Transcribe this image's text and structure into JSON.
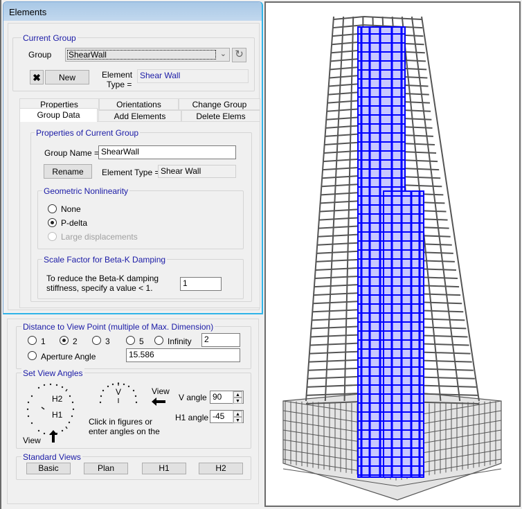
{
  "window": {
    "title": "Elements"
  },
  "current_group": {
    "legend": "Current Group",
    "group_label": "Group",
    "group_value": "ShearWall",
    "new_label": "New",
    "element_type_label_1": "Element",
    "element_type_label_2": "Type =",
    "element_type_value": "Shear Wall"
  },
  "tabs": {
    "row1": [
      "Properties",
      "Orientations",
      "Change Group"
    ],
    "row2": [
      "Group Data",
      "Add Elements",
      "Delete Elems"
    ],
    "active": "Group Data"
  },
  "group_data": {
    "legend": "Properties of Current Group",
    "group_name_label": "Group Name =",
    "group_name_value": "ShearWall",
    "rename_label": "Rename",
    "element_type_label": "Element Type =",
    "element_type_value": "Shear Wall",
    "nonlinearity": {
      "legend": "Geometric Nonlinearity",
      "options": [
        "None",
        "P-delta",
        "Large displacements"
      ],
      "selected": "P-delta",
      "disabled": [
        "Large displacements"
      ]
    },
    "damping": {
      "legend": "Scale Factor for Beta-K Damping",
      "text_1": "To reduce the Beta-K damping",
      "text_2": "stiffness, specify a value < 1.",
      "value": "1"
    }
  },
  "distance": {
    "legend": "Distance to View Point (multiple of Max. Dimension)",
    "options": [
      "1",
      "2",
      "3",
      "5",
      "Infinity"
    ],
    "selected": "2",
    "value": "2",
    "aperture_label": "Aperture Angle",
    "aperture_value": "15.586"
  },
  "view_angles": {
    "legend": "Set View Angles",
    "h2_label": "H2",
    "h1_label": "H1",
    "v_label": "V",
    "view_label_bottom": "View",
    "view_label_right": "View",
    "hint_1": "Click in figures or",
    "hint_2": "enter angles on the",
    "v_angle_label": "V angle",
    "v_angle_value": "90",
    "h1_angle_label": "H1 angle",
    "h1_angle_value": "-45"
  },
  "standard_views": {
    "legend": "Standard Views",
    "buttons": [
      "Basic",
      "Plan",
      "H1",
      "H2"
    ]
  },
  "colors": {
    "shear_wall": "#0000ff",
    "frame": "#555555",
    "legend_text": "#1a1aa6"
  }
}
